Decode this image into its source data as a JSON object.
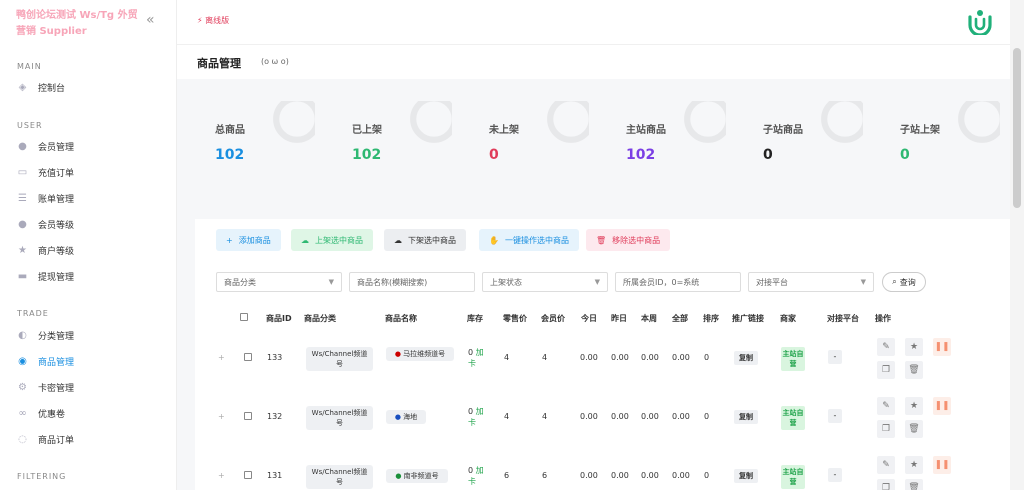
{
  "brand": {
    "title": "鸭创论坛测试 Ws/Tg 外贸营销 Supplier"
  },
  "sidebar": {
    "sections": {
      "main": "MAIN",
      "user": "USER",
      "trade": "TRADE",
      "filtering": "FILTERING"
    },
    "items": [
      {
        "label": "控制台",
        "icon": "dashboard-icon"
      },
      {
        "label": "会员管理",
        "icon": "user-icon"
      },
      {
        "label": "充值订单",
        "icon": "card-icon"
      },
      {
        "label": "账单管理",
        "icon": "list-icon"
      },
      {
        "label": "会员等级",
        "icon": "users-icon"
      },
      {
        "label": "商户等级",
        "icon": "star-icon"
      },
      {
        "label": "提现管理",
        "icon": "wallet-icon"
      },
      {
        "label": "分类管理",
        "icon": "category-icon"
      },
      {
        "label": "商品管理",
        "icon": "product-icon",
        "active": true
      },
      {
        "label": "卡密管理",
        "icon": "gear-icon"
      },
      {
        "label": "优惠卷",
        "icon": "link-icon"
      },
      {
        "label": "商品订单",
        "icon": "order-icon"
      }
    ]
  },
  "topbar": {
    "offline": "离线版"
  },
  "page": {
    "title": "商品管理",
    "face": "(o ω o)"
  },
  "stats": [
    {
      "label": "总商品",
      "value": "102",
      "color": "#1a8fe0"
    },
    {
      "label": "已上架",
      "value": "102",
      "color": "#2eb872"
    },
    {
      "label": "未上架",
      "value": "0",
      "color": "#e03c5a"
    },
    {
      "label": "主站商品",
      "value": "102",
      "color": "#7b3fe4"
    },
    {
      "label": "子站商品",
      "value": "0",
      "color": "#222222"
    },
    {
      "label": "子站上架",
      "value": "0",
      "color": "#2eb872"
    }
  ],
  "actions": {
    "add": "添加商品",
    "shelve": "上架选中商品",
    "unshelve": "下架选中商品",
    "bulk": "一键操作选中商品",
    "remove": "移除选中商品"
  },
  "filters": {
    "category": "商品分类",
    "name_placeholder": "商品名称(模糊搜索)",
    "status": "上架状态",
    "member_placeholder": "所属会员ID，0=系统",
    "platform": "对接平台",
    "query": "查询"
  },
  "table": {
    "headers": [
      "商品ID",
      "商品分类",
      "商品名称",
      "库存",
      "零售价",
      "会员价",
      "今日",
      "昨日",
      "本周",
      "全部",
      "排序",
      "推广链接",
      "商家",
      "对接平台",
      "操作"
    ],
    "rows": [
      {
        "id": "133",
        "category": "Ws/Channel频道号",
        "name": "马拉维频道号",
        "stock": "0",
        "stock_unit": "卡",
        "retail": "4",
        "member": "4",
        "today": "0.00",
        "yesterday": "0.00",
        "week": "0.00",
        "all": "0.00",
        "sort": "0",
        "link": "复制",
        "merchant": "主站自营",
        "platform": "-"
      },
      {
        "id": "132",
        "category": "Ws/Channel频道号",
        "name": "海地",
        "stock": "0",
        "stock_unit": "卡",
        "retail": "4",
        "member": "4",
        "today": "0.00",
        "yesterday": "0.00",
        "week": "0.00",
        "all": "0.00",
        "sort": "0",
        "link": "复制",
        "merchant": "主站自营",
        "platform": "-"
      },
      {
        "id": "131",
        "category": "Ws/Channel频道号",
        "name": "南非频道号",
        "stock": "0",
        "stock_unit": "卡",
        "retail": "6",
        "member": "6",
        "today": "0.00",
        "yesterday": "0.00",
        "week": "0.00",
        "all": "0.00",
        "sort": "0",
        "link": "复制",
        "merchant": "主站自营",
        "platform": "-"
      }
    ],
    "add_label": "加"
  }
}
